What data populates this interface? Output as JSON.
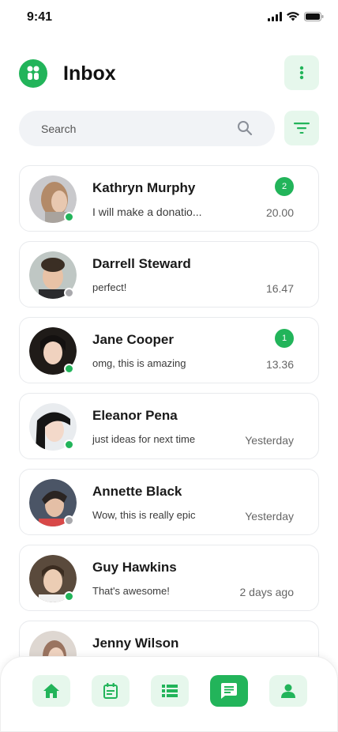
{
  "status_bar": {
    "time": "9:41"
  },
  "header": {
    "title": "Inbox"
  },
  "search": {
    "placeholder": "Search"
  },
  "colors": {
    "accent": "#22b45a",
    "accent_soft": "#e6f7ec",
    "online": "#22b45a",
    "offline": "#a8a8ac"
  },
  "conversations": [
    {
      "name": "Kathryn Murphy",
      "message": "I will make a donatio...",
      "time": "20.00",
      "unread": "2",
      "online": true
    },
    {
      "name": "Darrell Steward",
      "message": "perfect!",
      "time": "16.47",
      "unread": null,
      "online": false
    },
    {
      "name": "Jane Cooper",
      "message": "omg, this is amazing",
      "time": "13.36",
      "unread": "1",
      "online": true
    },
    {
      "name": "Eleanor Pena",
      "message": "just ideas for next time",
      "time": "Yesterday",
      "unread": null,
      "online": true
    },
    {
      "name": "Annette Black",
      "message": "Wow, this is really epic",
      "time": "Yesterday",
      "unread": null,
      "online": false
    },
    {
      "name": "Guy Hawkins",
      "message": "That's awesome!",
      "time": "2 days ago",
      "unread": null,
      "online": true
    },
    {
      "name": "Jenny Wilson",
      "message": "",
      "time": "",
      "unread": null,
      "online": null
    }
  ],
  "bottom_nav": [
    {
      "icon": "home-icon",
      "active": false
    },
    {
      "icon": "calendar-icon",
      "active": false
    },
    {
      "icon": "list-icon",
      "active": false
    },
    {
      "icon": "chat-icon",
      "active": true
    },
    {
      "icon": "profile-icon",
      "active": false
    }
  ]
}
